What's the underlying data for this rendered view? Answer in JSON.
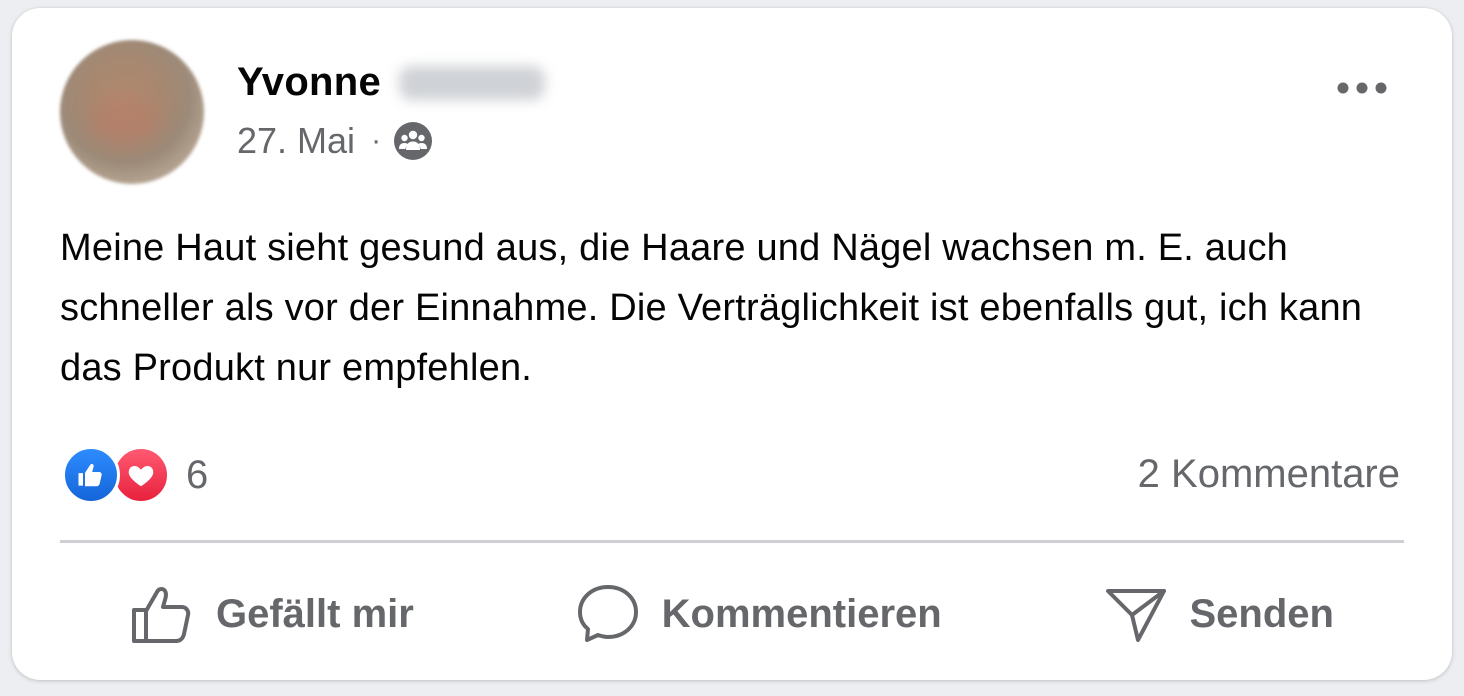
{
  "post": {
    "author_first_name": "Yvonne",
    "date": "27. Mai",
    "separator": "·",
    "audience_icon": "group-icon",
    "more_icon": "more-options-icon",
    "text": "Meine Haut sieht gesund aus, die Haare und Nägel wachsen m. E. auch schneller als vor der Einnahme. Die Verträglichkeit ist ebenfalls gut, ich kann das Produkt nur empfehlen."
  },
  "reactions": {
    "types": [
      "like-reaction-icon",
      "love-reaction-icon"
    ],
    "count": "6",
    "comments_label": "2 Kommentare"
  },
  "actions": {
    "like_label": "Gefällt mir",
    "comment_label": "Kommentieren",
    "send_label": "Senden"
  },
  "colors": {
    "secondary_text": "#65676b",
    "primary_text": "#050505",
    "like_blue": "#1877f2",
    "love_red": "#f33e58",
    "divider": "#ced0d4"
  }
}
